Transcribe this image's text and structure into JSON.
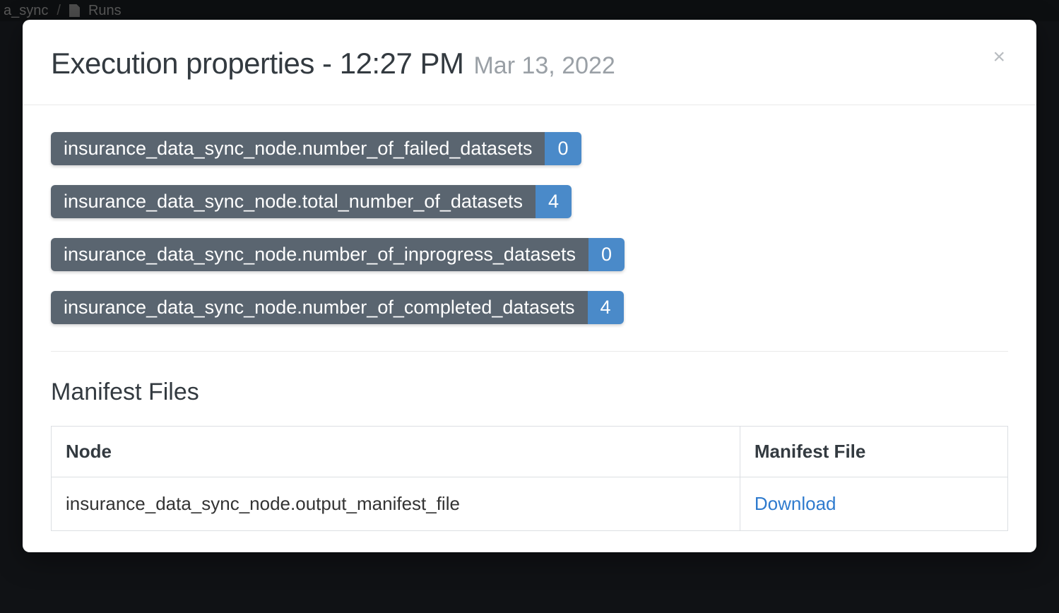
{
  "breadcrumb": {
    "segment1": "a_sync",
    "separator": "/",
    "segment2": "Runs"
  },
  "modal": {
    "title": "Execution properties - 12:27 PM",
    "date": "Mar 13, 2022",
    "close_glyph": "×",
    "properties": [
      {
        "label": "insurance_data_sync_node.number_of_failed_datasets",
        "value": "0"
      },
      {
        "label": "insurance_data_sync_node.total_number_of_datasets",
        "value": "4"
      },
      {
        "label": "insurance_data_sync_node.number_of_inprogress_datasets",
        "value": "0"
      },
      {
        "label": "insurance_data_sync_node.number_of_completed_datasets",
        "value": "4"
      }
    ],
    "manifest": {
      "section_title": "Manifest Files",
      "columns": {
        "node": "Node",
        "file": "Manifest File"
      },
      "rows": [
        {
          "node": "insurance_data_sync_node.output_manifest_file",
          "link": "Download"
        }
      ]
    }
  }
}
